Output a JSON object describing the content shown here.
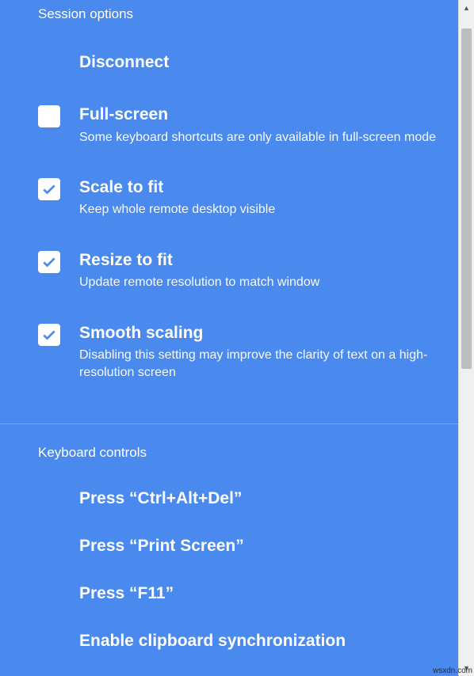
{
  "sessionOptions": {
    "header": "Session options",
    "disconnect": {
      "title": "Disconnect"
    },
    "fullscreen": {
      "title": "Full-screen",
      "sub": "Some keyboard shortcuts are only available in full-screen mode",
      "checked": false
    },
    "scaleToFit": {
      "title": "Scale to fit",
      "sub": "Keep whole remote desktop visible",
      "checked": true
    },
    "resizeToFit": {
      "title": "Resize to fit",
      "sub": "Update remote resolution to match window",
      "checked": true
    },
    "smoothScaling": {
      "title": "Smooth scaling",
      "sub": "Disabling this setting may improve the clarity of text on a high-resolution screen",
      "checked": true
    }
  },
  "keyboardControls": {
    "header": "Keyboard controls",
    "ctrlAltDel": "Press “Ctrl+Alt+Del”",
    "printScreen": "Press “Print Screen”",
    "f11": "Press “F11”",
    "clipboard": "Enable clipboard synchronization"
  },
  "colors": {
    "panel_bg": "#4a89ee",
    "check_fill": "#4a89ee"
  },
  "watermark": "wsxdn.com"
}
